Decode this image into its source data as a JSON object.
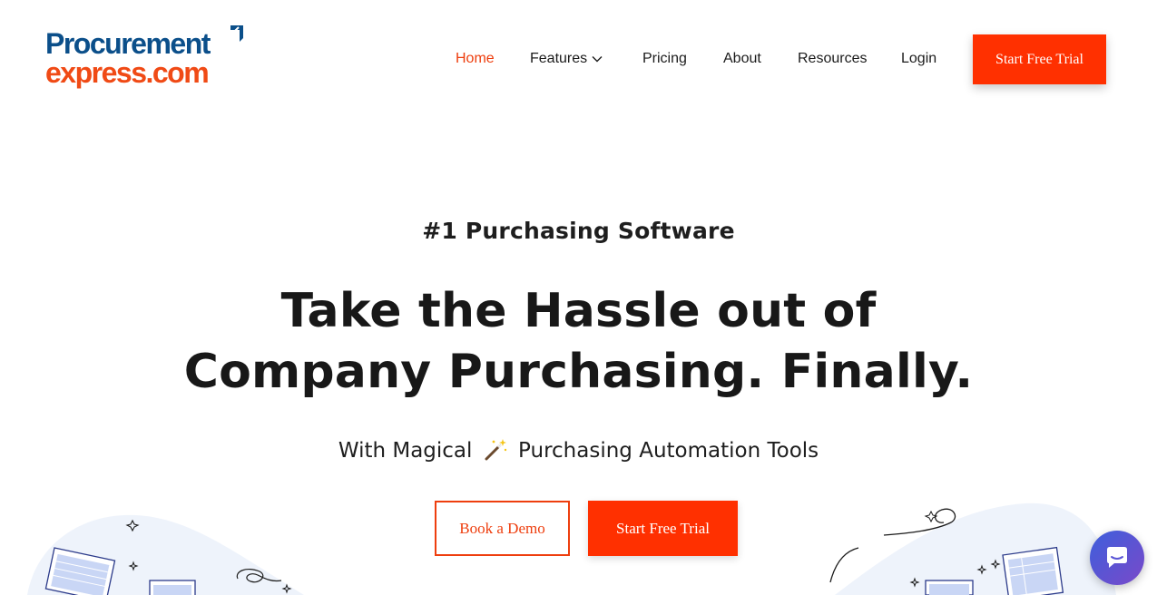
{
  "brand": {
    "line1": "Procurement",
    "line2": "express.com"
  },
  "nav": {
    "items": [
      {
        "label": "Home",
        "active": true
      },
      {
        "label": "Features",
        "dropdown": true
      },
      {
        "label": "Pricing"
      },
      {
        "label": "About"
      },
      {
        "label": "Resources"
      },
      {
        "label": "Login"
      }
    ],
    "cta_label": "Start Free Trial"
  },
  "hero": {
    "eyebrow": "#1 Purchasing Software",
    "headline_line1": "Take the Hassle out of",
    "headline_line2": "Company Purchasing. Finally.",
    "subhead_before": "With Magical",
    "subhead_icon": "magic-wand-icon",
    "subhead_after": "Purchasing Automation Tools",
    "demo_label": "Book a Demo",
    "trial_label": "Start Free Trial"
  },
  "chat": {
    "icon": "chat-bubble-icon"
  },
  "colors": {
    "accent": "#ff3000",
    "accent_text": "#ee3e0e",
    "brand_blue": "#0b4f8a",
    "brand_orange": "#f04a15",
    "chat_gradient_start": "#3d5fdc",
    "chat_gradient_end": "#7a49c9"
  }
}
